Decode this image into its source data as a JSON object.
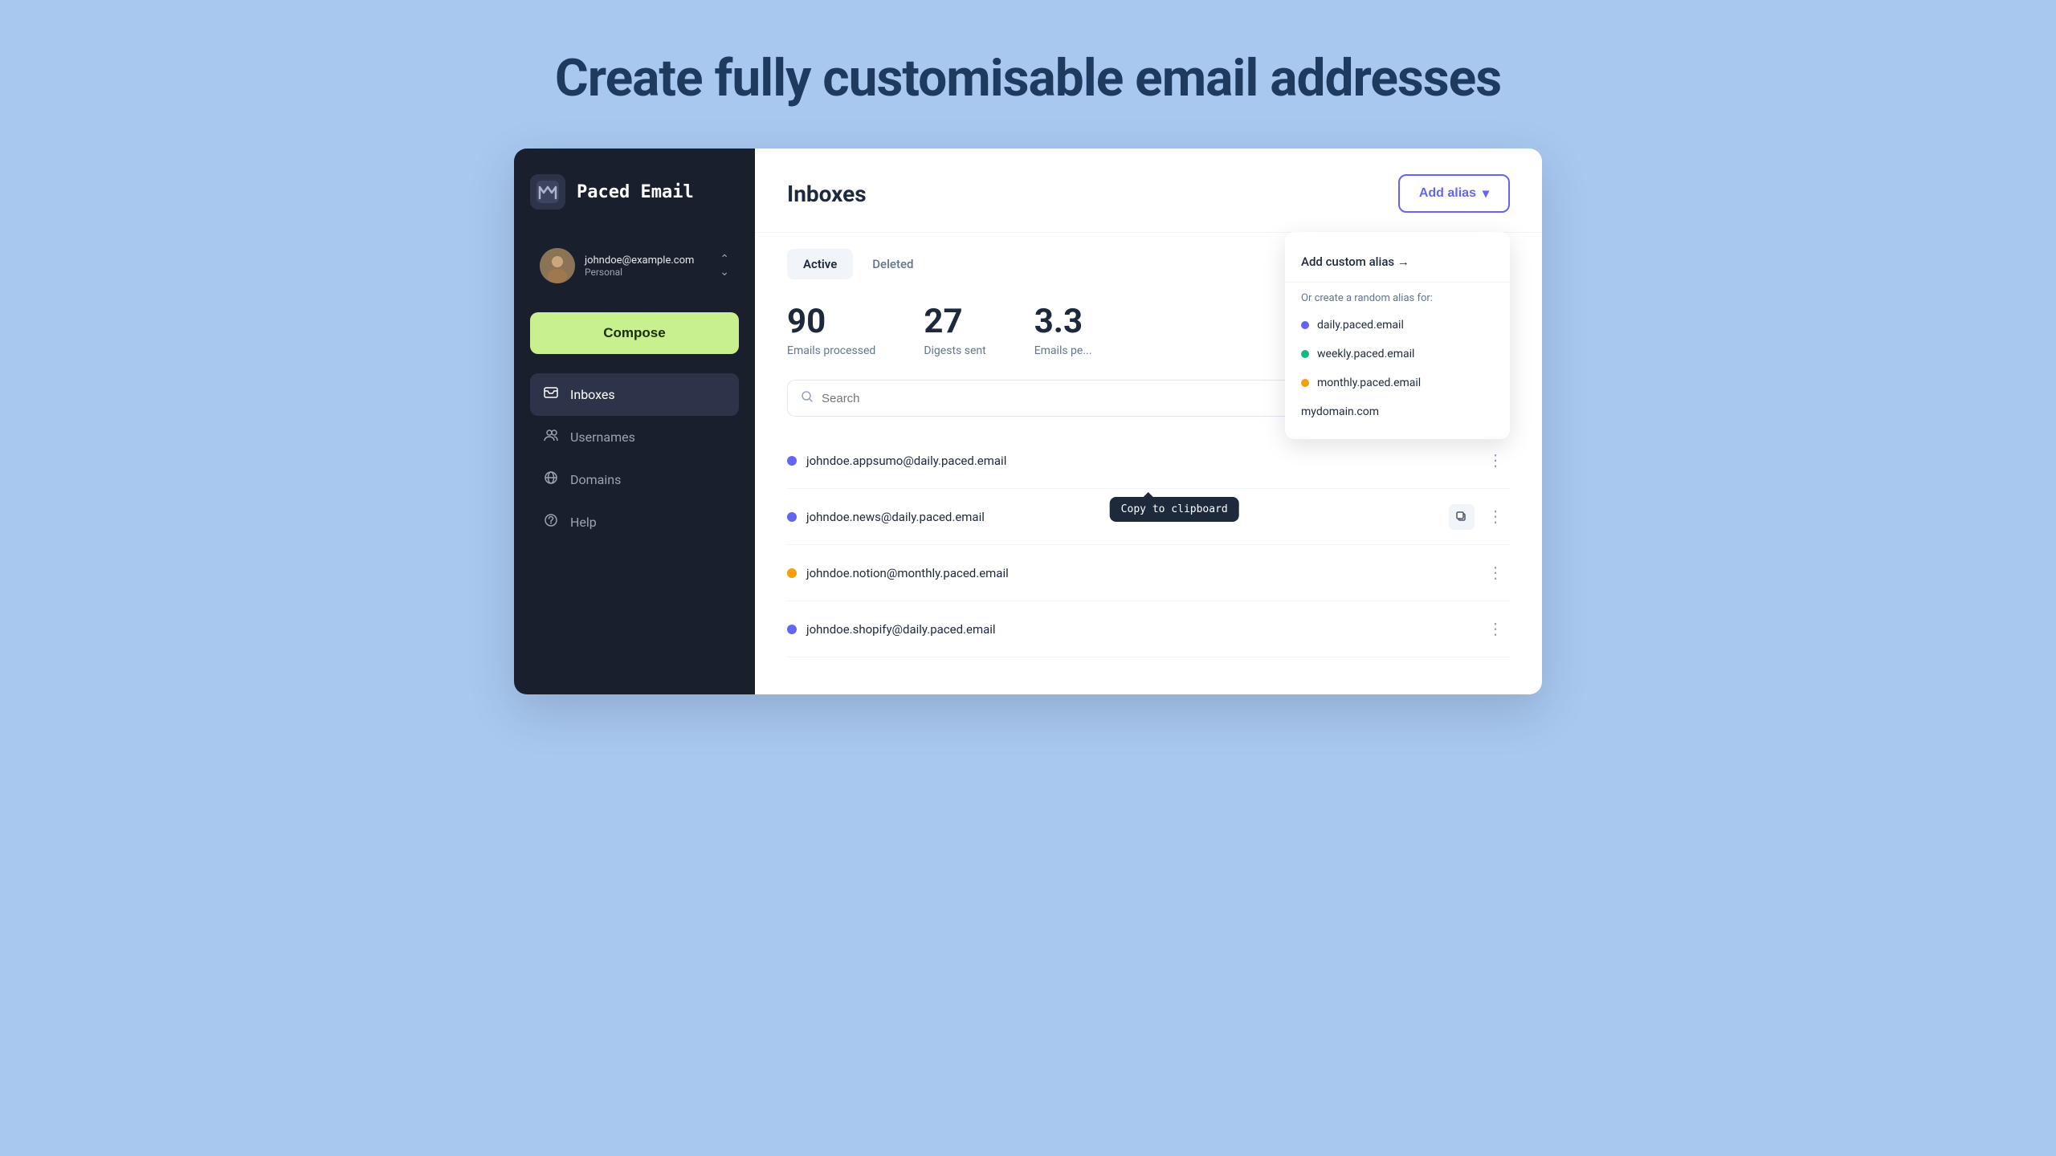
{
  "page": {
    "headline": "Create fully customisable email addresses"
  },
  "sidebar": {
    "logo_icon": "M",
    "logo_text": "Paced Email",
    "user_email": "johndoe@example.com",
    "user_plan": "Personal",
    "compose_label": "Compose",
    "nav_items": [
      {
        "id": "inboxes",
        "label": "Inboxes",
        "active": true
      },
      {
        "id": "usernames",
        "label": "Usernames",
        "active": false
      },
      {
        "id": "domains",
        "label": "Domains",
        "active": false
      },
      {
        "id": "help",
        "label": "Help",
        "active": false
      }
    ]
  },
  "main": {
    "title": "Inboxes",
    "add_alias_label": "Add alias",
    "tabs": [
      {
        "id": "active",
        "label": "Active",
        "active": true
      },
      {
        "id": "deleted",
        "label": "Deleted",
        "active": false
      }
    ],
    "stats": [
      {
        "id": "emails_processed",
        "number": "90",
        "label": "Emails processed"
      },
      {
        "id": "digests_sent",
        "number": "27",
        "label": "Digests sent"
      },
      {
        "id": "emails_per",
        "number": "3.3",
        "label": "Emails pe..."
      }
    ],
    "search_placeholder": "Search",
    "inbox_items": [
      {
        "id": "item1",
        "email": "johndoe.appsumo@daily.paced.email",
        "dot": "blue",
        "show_copy": false,
        "show_tooltip": true
      },
      {
        "id": "item2",
        "email": "johndoe.news@daily.paced.email",
        "dot": "blue",
        "show_copy": true,
        "show_tooltip": false
      },
      {
        "id": "item3",
        "email": "johndoe.notion@monthly.paced.email",
        "dot": "yellow",
        "show_copy": false,
        "show_tooltip": false
      },
      {
        "id": "item4",
        "email": "johndoe.shopify@daily.paced.email",
        "dot": "blue",
        "show_copy": false,
        "show_tooltip": false
      }
    ],
    "tooltip_text": "Copy to clipboard"
  },
  "dropdown": {
    "custom_alias_label": "Add custom alias →",
    "section_label": "Or create a random alias for:",
    "options": [
      {
        "id": "daily",
        "label": "daily.paced.email",
        "dot": "blue"
      },
      {
        "id": "weekly",
        "label": "weekly.paced.email",
        "dot": "green"
      },
      {
        "id": "monthly",
        "label": "monthly.paced.email",
        "dot": "yellow"
      },
      {
        "id": "domain",
        "label": "mydomain.com",
        "dot": "none"
      }
    ]
  }
}
